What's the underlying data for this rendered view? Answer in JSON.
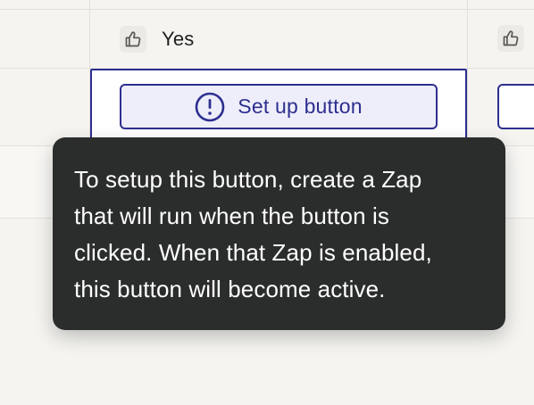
{
  "table": {
    "row1": {
      "value": "Yes"
    },
    "row2": {
      "button_label": "Set up button"
    }
  },
  "tooltip": {
    "lines": [
      "To setup this button, create a Zap",
      "that will run when the button is",
      "clicked. When that Zap is enabled,",
      "this button will become active."
    ]
  },
  "icons": {
    "thumb": "thumbs-up-icon",
    "alert": "alert-circle-icon"
  },
  "colors": {
    "accent": "#2d2f8f",
    "tooltip_bg": "#2b2d2c",
    "page_bg": "#f5f4f0"
  }
}
